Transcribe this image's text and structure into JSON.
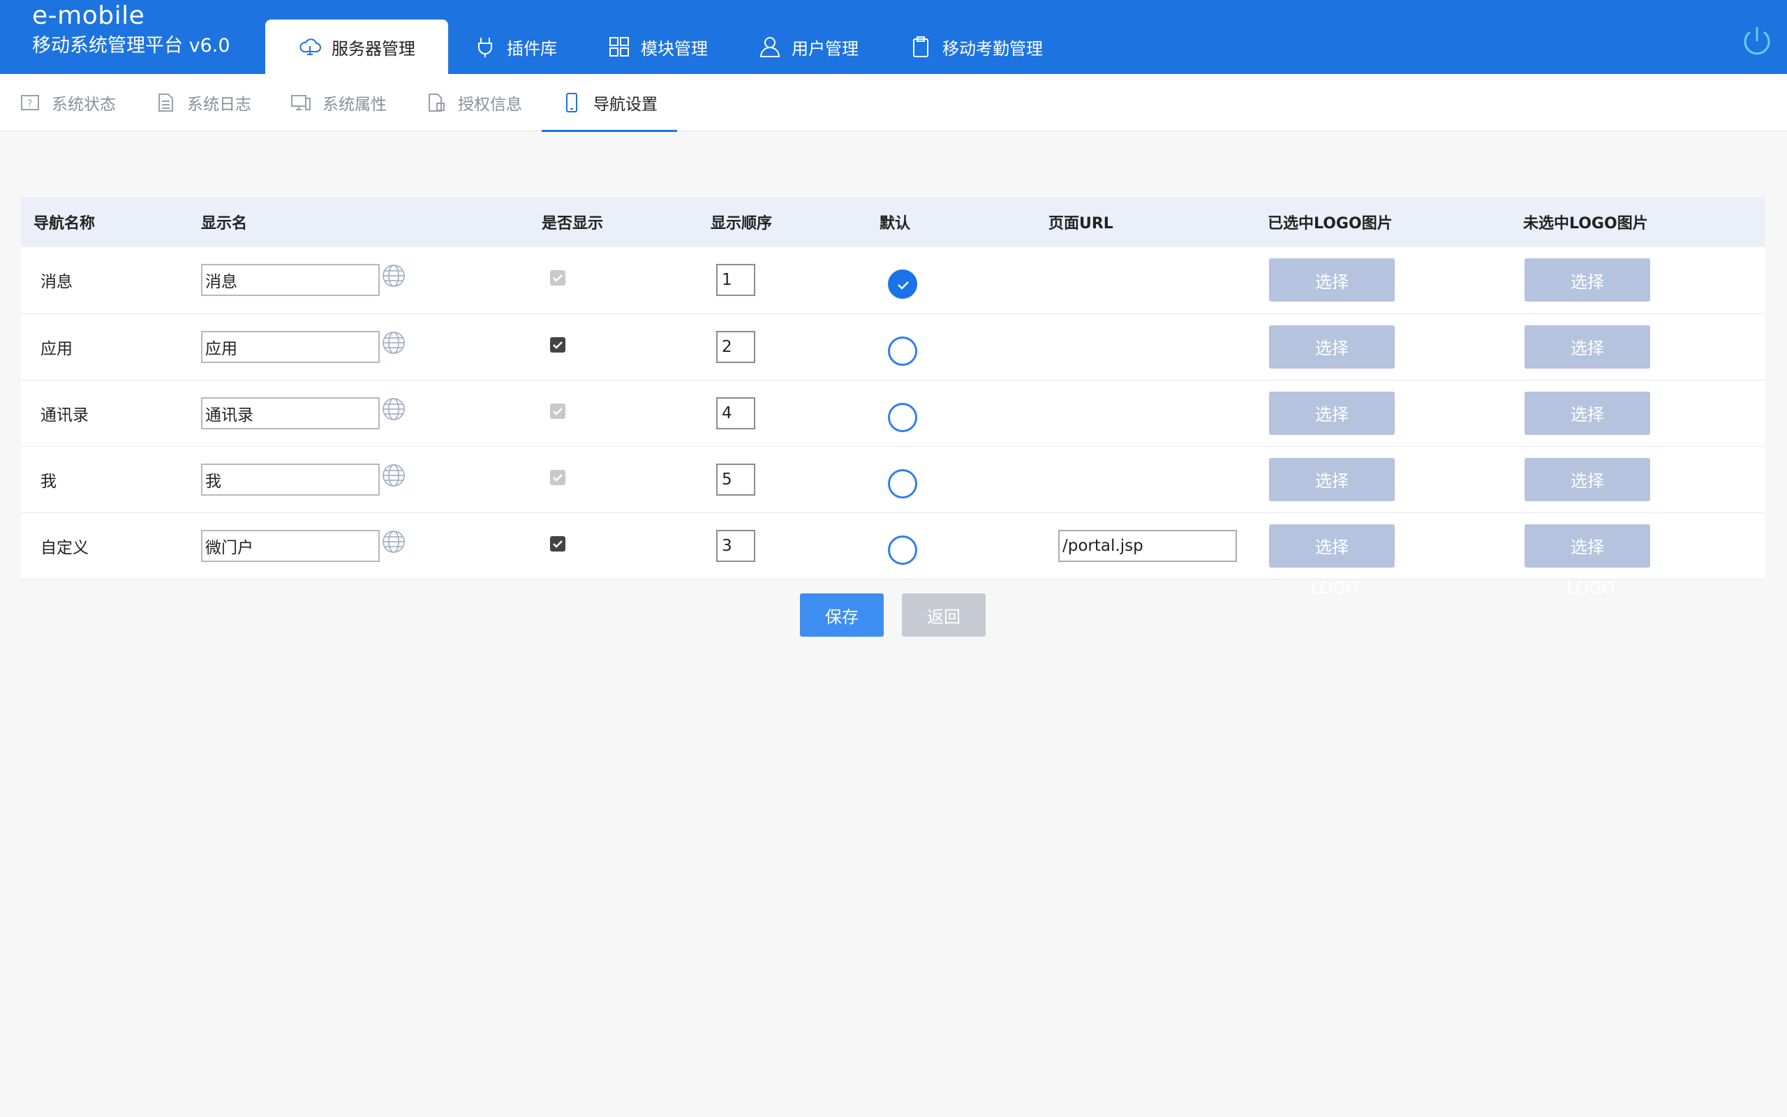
{
  "brand": {
    "name": "e-mobile",
    "subtitle": "移动系统管理平台 v6.0"
  },
  "main_tabs": [
    {
      "label": "服务器管理",
      "icon": "cloud-icon",
      "active": true
    },
    {
      "label": "插件库",
      "icon": "plug-icon",
      "active": false
    },
    {
      "label": "模块管理",
      "icon": "modules-icon",
      "active": false
    },
    {
      "label": "用户管理",
      "icon": "user-icon",
      "active": false
    },
    {
      "label": "移动考勤管理",
      "icon": "clipboard-icon",
      "active": false
    }
  ],
  "sub_tabs": [
    {
      "label": "系统状态",
      "icon": "status-icon",
      "active": false
    },
    {
      "label": "系统日志",
      "icon": "log-icon",
      "active": false
    },
    {
      "label": "系统属性",
      "icon": "monitor-icon",
      "active": false
    },
    {
      "label": "授权信息",
      "icon": "license-icon",
      "active": false
    },
    {
      "label": "导航设置",
      "icon": "phone-icon",
      "active": true
    }
  ],
  "table": {
    "headers": [
      "导航名称",
      "显示名",
      "是否显示",
      "显示顺序",
      "默认",
      "页面URL",
      "已选中LOGO图片",
      "未选中LOGO图片"
    ],
    "rows": [
      {
        "name": "消息",
        "display": "消息",
        "show": true,
        "show_disabled": true,
        "order": "1",
        "default": true,
        "url": null,
        "pick_selected": "选择",
        "pick_unselected": "选择"
      },
      {
        "name": "应用",
        "display": "应用",
        "show": true,
        "show_disabled": false,
        "order": "2",
        "default": false,
        "url": null,
        "pick_selected": "选择",
        "pick_unselected": "选择"
      },
      {
        "name": "通讯录",
        "display": "通讯录",
        "show": true,
        "show_disabled": true,
        "order": "4",
        "default": false,
        "url": null,
        "pick_selected": "选择",
        "pick_unselected": "选择"
      },
      {
        "name": "我",
        "display": "我",
        "show": true,
        "show_disabled": true,
        "order": "5",
        "default": false,
        "url": null,
        "pick_selected": "选择",
        "pick_unselected": "选择"
      },
      {
        "name": "自定义",
        "display": "微门户",
        "show": true,
        "show_disabled": false,
        "order": "3",
        "default": false,
        "url": "/portal.jsp",
        "pick_selected": "选择",
        "pick_unselected": "选择"
      }
    ],
    "ghost_logo_labels": [
      "LOGO",
      "LOGO"
    ]
  },
  "actions": {
    "save": "保存",
    "back": "返回"
  },
  "colors": {
    "header_blue": "#1d74e0",
    "radio_blue": "#1a73e8",
    "pick_button": "#b5c3df",
    "save_button": "#3d8ef0",
    "back_button": "#c6cbd3"
  }
}
